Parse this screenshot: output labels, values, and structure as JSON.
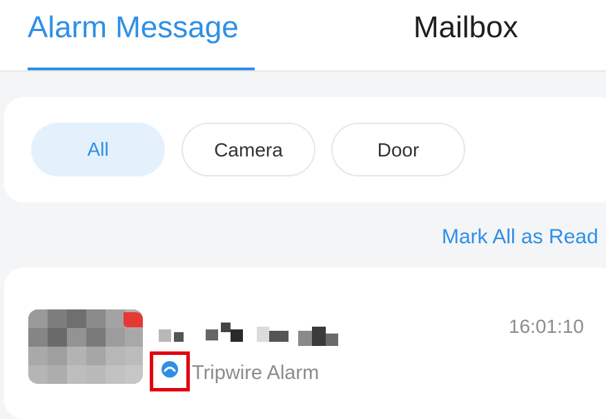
{
  "tabs": {
    "alarm_message": "Alarm Message",
    "mailbox": "Mailbox",
    "active": "alarm_message"
  },
  "filters": {
    "all": "All",
    "camera": "Camera",
    "door": "Door",
    "selected": "all"
  },
  "actions": {
    "mark_all_read": "Mark All as Read"
  },
  "alarms": [
    {
      "device_name": "",
      "time": "16:01:10",
      "type": "Tripwire Alarm",
      "type_icon": "tripwire-alarm-icon",
      "unread": true
    }
  ],
  "colors": {
    "accent": "#2f8fe6",
    "selected_chip_bg": "#e4f1fd",
    "unread": "#e53935",
    "highlight_box": "#e3000f",
    "secondary_text": "#8c8c8c"
  }
}
